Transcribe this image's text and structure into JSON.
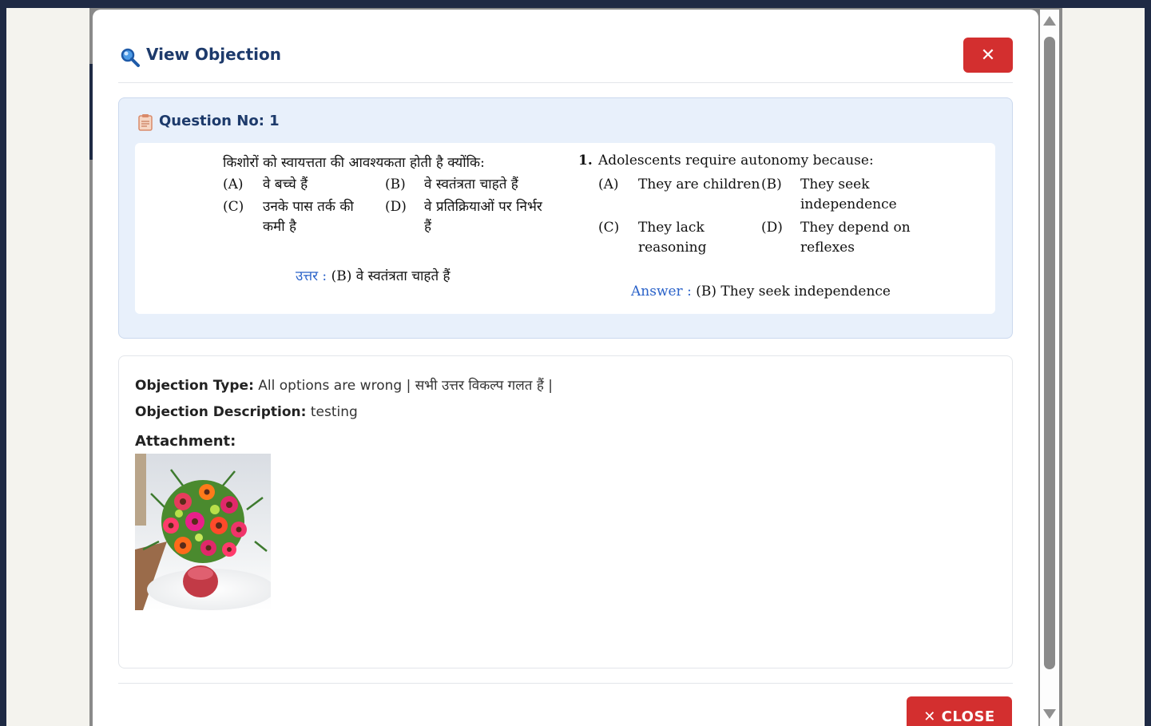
{
  "modal": {
    "title": "View Objection",
    "title_icon": "search-icon",
    "close_icon_glyph": "✕"
  },
  "question": {
    "header": "Question No: 1",
    "header_icon": "clipboard-icon",
    "hindi": {
      "stem": "किशोरों को स्वायत्तता की आवश्यकता होती है क्योंकि:",
      "options": [
        {
          "key": "(A)",
          "text": "वे बच्चे हैं"
        },
        {
          "key": "(B)",
          "text": "वे स्वतंत्रता चाहते हैं"
        },
        {
          "key": "(C)",
          "text": "उनके पास तर्क की कमी है"
        },
        {
          "key": "(D)",
          "text": "वे प्रतिक्रियाओं पर निर्भर हैं"
        }
      ],
      "answer_label": "उत्तर :",
      "answer_text": "(B) वे स्वतंत्रता चाहते हैं"
    },
    "english": {
      "number": "1.",
      "stem": "Adolescents require autonomy because:",
      "options": [
        {
          "key": "(A)",
          "text": "They are children"
        },
        {
          "key": "(B)",
          "text": "They seek independence"
        },
        {
          "key": "(C)",
          "text": "They lack reasoning"
        },
        {
          "key": "(D)",
          "text": "They depend on reflexes"
        }
      ],
      "answer_label": "Answer :",
      "answer_text": "(B) They seek independence"
    }
  },
  "objection": {
    "type_label": "Objection Type:",
    "type_value": "All options are wrong | सभी उत्तर विकल्प गलत हैं |",
    "description_label": "Objection Description:",
    "description_value": "testing",
    "attachment_label": "Attachment:",
    "attachment_alt": "flower bouquet"
  },
  "footer": {
    "close_label": "✕ CLOSE"
  },
  "colors": {
    "accent_red": "#d32f2f",
    "title_blue": "#1d3a6b",
    "answer_blue": "#2a62c9",
    "card_bg": "#e8f0fb"
  }
}
